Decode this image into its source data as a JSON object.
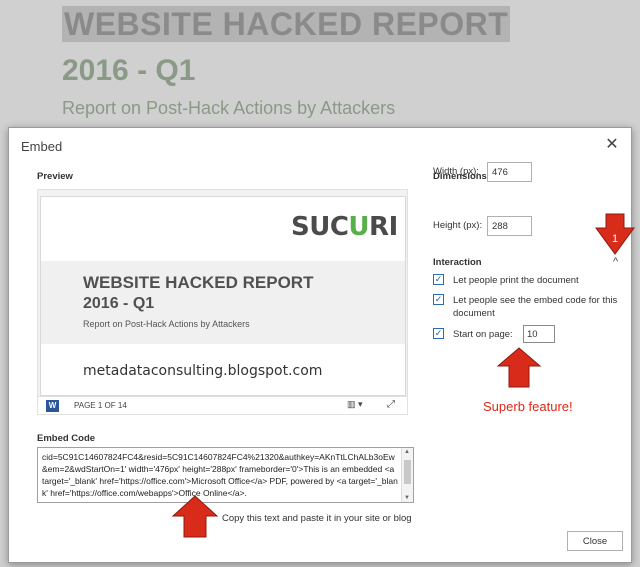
{
  "background_doc": {
    "title_line1": "WEBSITE HACKED REPORT",
    "title_line2": "2016 - Q1",
    "subtitle": "Report on Post-Hack Actions by Attackers"
  },
  "dialog": {
    "title": "Embed",
    "close_glyph": "✕",
    "preview_label": "Preview",
    "preview": {
      "brand_logo": "sucuri",
      "doc_title_line1": "WEBSITE HACKED REPORT",
      "doc_title_line2": "2016 - Q1",
      "doc_subtitle": "Report on Post-Hack Actions by Attackers",
      "watermark_text": "metadataconsulting.blogspot.com",
      "page_indicator": "PAGE 1 OF 14",
      "word_icon_letter": "W",
      "view_menu_glyph": "▥ ▾",
      "fullscreen_glyph": "⤢"
    },
    "dimensions": {
      "label": "Dimensions",
      "width_label": "Width (px):",
      "width_value": "476",
      "height_label": "Height (px):",
      "height_value": "288"
    },
    "interaction": {
      "label": "Interaction",
      "collapse_glyph": "^",
      "print_label": "Let people print the document",
      "print_checked": true,
      "embed_label": "Let people see the embed code for this document",
      "embed_checked": true,
      "start_label": "Start on page:",
      "start_checked": true,
      "start_value": "10"
    },
    "embed_code": {
      "label": "Embed Code",
      "code": "cid=5C91C14607824FC4&resid=5C91C14607824FC4%21320&authkey=AKnTtLChALb3oEw&em=2&wdStartOn=1' width='476px' height='288px' frameborder='0'>This is an embedded <a target='_blank' href='https://office.com'>Microsoft Office</a> PDF, powered by <a target='_blank' href='https://office.com/webapps'>Office Online</a>.",
      "hint": "Copy this text and paste it in your site or blog"
    },
    "close_button": "Close"
  },
  "annotations": {
    "badge_number": "1",
    "callout_text": "Superb feature!",
    "arrow_color": "#d92b1a"
  }
}
